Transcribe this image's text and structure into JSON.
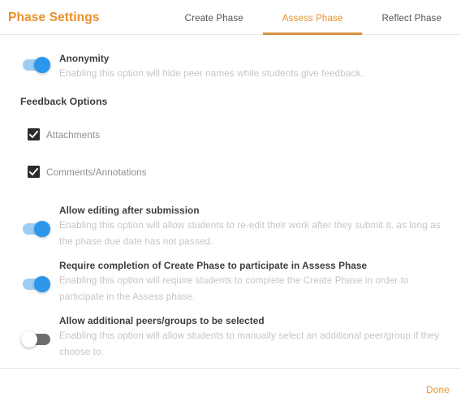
{
  "header": {
    "title": "Phase Settings",
    "title_color": "#e8912d",
    "tabs": [
      {
        "label": "Create Phase",
        "active": false
      },
      {
        "label": "Assess Phase",
        "active": true
      },
      {
        "label": "Reflect Phase",
        "active": false
      }
    ],
    "active_tab_color": "#e8912d",
    "active_tab_underline_color": "#d79442"
  },
  "settings": {
    "anonymity": {
      "title": "Anonymity",
      "description": "Enabling this option will hide peer names while students give feedback.",
      "toggle_state": "on"
    },
    "feedback_options_heading": "Feedback Options",
    "checkboxes": [
      {
        "label": "Attachments",
        "checked": true
      },
      {
        "label": "Comments/Annotations",
        "checked": true
      }
    ],
    "allow_editing": {
      "title": "Allow editing after submission",
      "description": "Enabling this option will allow students to re-edit their work after they submit it. as long as the phase due date has not passed.",
      "toggle_state": "on"
    },
    "require_create_phase": {
      "title": "Require completion of Create Phase to participate in Assess Phase",
      "description": "Enabling this option will require students to complete the Create Phase in order to participate in the Assess phase.",
      "toggle_state": "on"
    },
    "allow_additional_peers": {
      "title": "Allow additional peers/groups to be selected",
      "description": "Enabling this option will allow students to manually select an additional peer/group if they choose to.",
      "toggle_state": "off"
    }
  },
  "footer": {
    "done_label": "Done",
    "done_color": "#e8912d"
  },
  "colors": {
    "toggle_on_track": "#9fcdf2",
    "toggle_on_knob": "#2c96eb",
    "toggle_off_track": "#6e6e6e",
    "toggle_off_knob": "#ffffff",
    "checkbox_fill": "#2b2b2b",
    "title_text": "#3d3d3d",
    "description_text": "#c6c6c8",
    "divider": "#e6e6e6"
  }
}
